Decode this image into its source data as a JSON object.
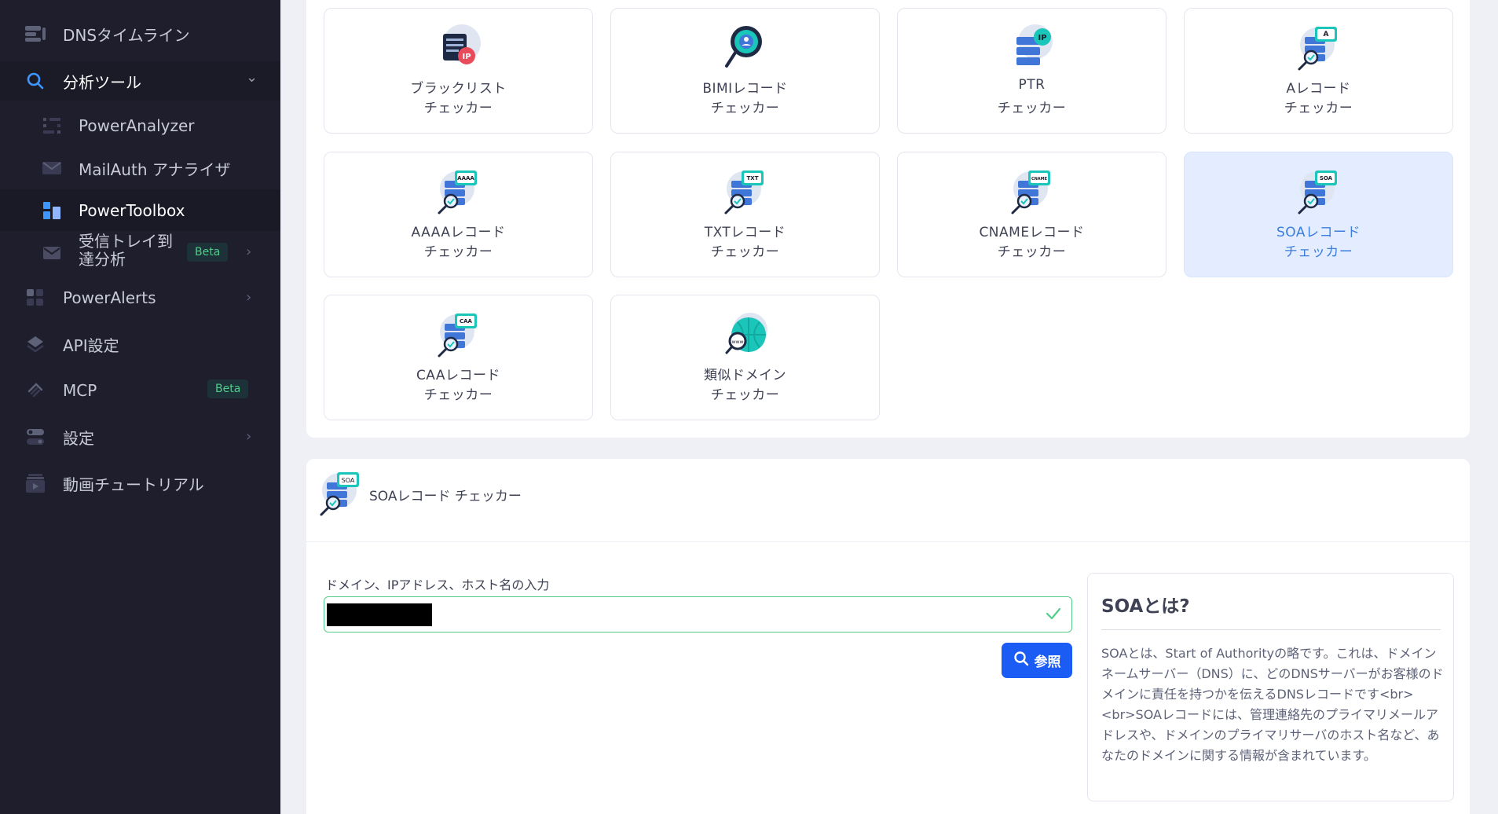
{
  "sidebar": {
    "items": [
      {
        "label": "DNSタイムライン",
        "icon": "timeline-icon"
      },
      {
        "label": "分析ツール",
        "icon": "search-icon",
        "chevron": "⌄"
      },
      {
        "label": "PowerAnalyzer",
        "icon": "analyzer-icon"
      },
      {
        "label": "MailAuth アナライザ",
        "icon": "mail-auth-icon"
      },
      {
        "label": "PowerToolbox",
        "icon": "toolbox-icon"
      },
      {
        "label_line1": "受信トレイ到",
        "label_line2": "達分析",
        "icon": "mail-icon",
        "badge": "Beta",
        "chevron": "›"
      },
      {
        "label": "PowerAlerts",
        "icon": "alerts-icon",
        "chevron": "›"
      },
      {
        "label": "API設定",
        "icon": "api-icon"
      },
      {
        "label": "MCP",
        "icon": "mcp-icon",
        "badge": "Beta"
      },
      {
        "label": "設定",
        "icon": "settings-icon",
        "chevron": "›"
      },
      {
        "label": "動画チュートリアル",
        "icon": "video-icon"
      }
    ]
  },
  "tools": [
    {
      "title": "ブラックリスト",
      "sub": "チェッカー",
      "icon": "blacklist-ip-icon"
    },
    {
      "title": "BIMIレコード",
      "sub": "チェッカー",
      "icon": "bimi-magnifier-icon"
    },
    {
      "title": "PTR",
      "sub": "チェッカー",
      "icon": "ptr-server-icon",
      "tag": "IP"
    },
    {
      "title": "Aレコード",
      "sub": "チェッカー",
      "icon": "a-record-icon",
      "tag": "A"
    },
    {
      "title": "AAAAレコード",
      "sub": "チェッカー",
      "icon": "aaaa-record-icon",
      "tag": "AAAA"
    },
    {
      "title": "TXTレコード",
      "sub": "チェッカー",
      "icon": "txt-record-icon",
      "tag": "TXT"
    },
    {
      "title": "CNAMEレコード",
      "sub": "チェッカー",
      "icon": "cname-record-icon",
      "tag": "CNAME"
    },
    {
      "title": "SOAレコード",
      "sub": "チェッカー",
      "icon": "soa-record-icon",
      "tag": "SOA",
      "selected": true
    },
    {
      "title": "CAAレコード",
      "sub": "チェッカー",
      "icon": "caa-record-icon",
      "tag": "CAA"
    },
    {
      "title": "類似ドメイン",
      "sub": "チェッカー",
      "icon": "similar-domain-icon",
      "tag": "www"
    }
  ],
  "detail": {
    "title": "SOAレコード チェッカー",
    "icon_tag": "SOA",
    "field_label": "ドメイン、IPアドレス、ホスト名の入力",
    "search_label": "参照",
    "info_title": "SOAとは?",
    "info_body": "SOAとは、Start of Authorityの略です。これは、ドメインネームサーバー（DNS）に、どのDNSサーバーがお客様のドメインに責任を持つかを伝えるDNSレコードです<br><br>SOAレコードには、管理連絡先のプライマリメールアドレスや、ドメインのプライマリサーバのホスト名など、あなたのドメインに関する情報が含まれています。"
  },
  "colors": {
    "sidebar_bg": "#1e1e2d",
    "accent": "#1b5cf5",
    "selected_card": "#e3edff",
    "success": "#50cd89"
  }
}
